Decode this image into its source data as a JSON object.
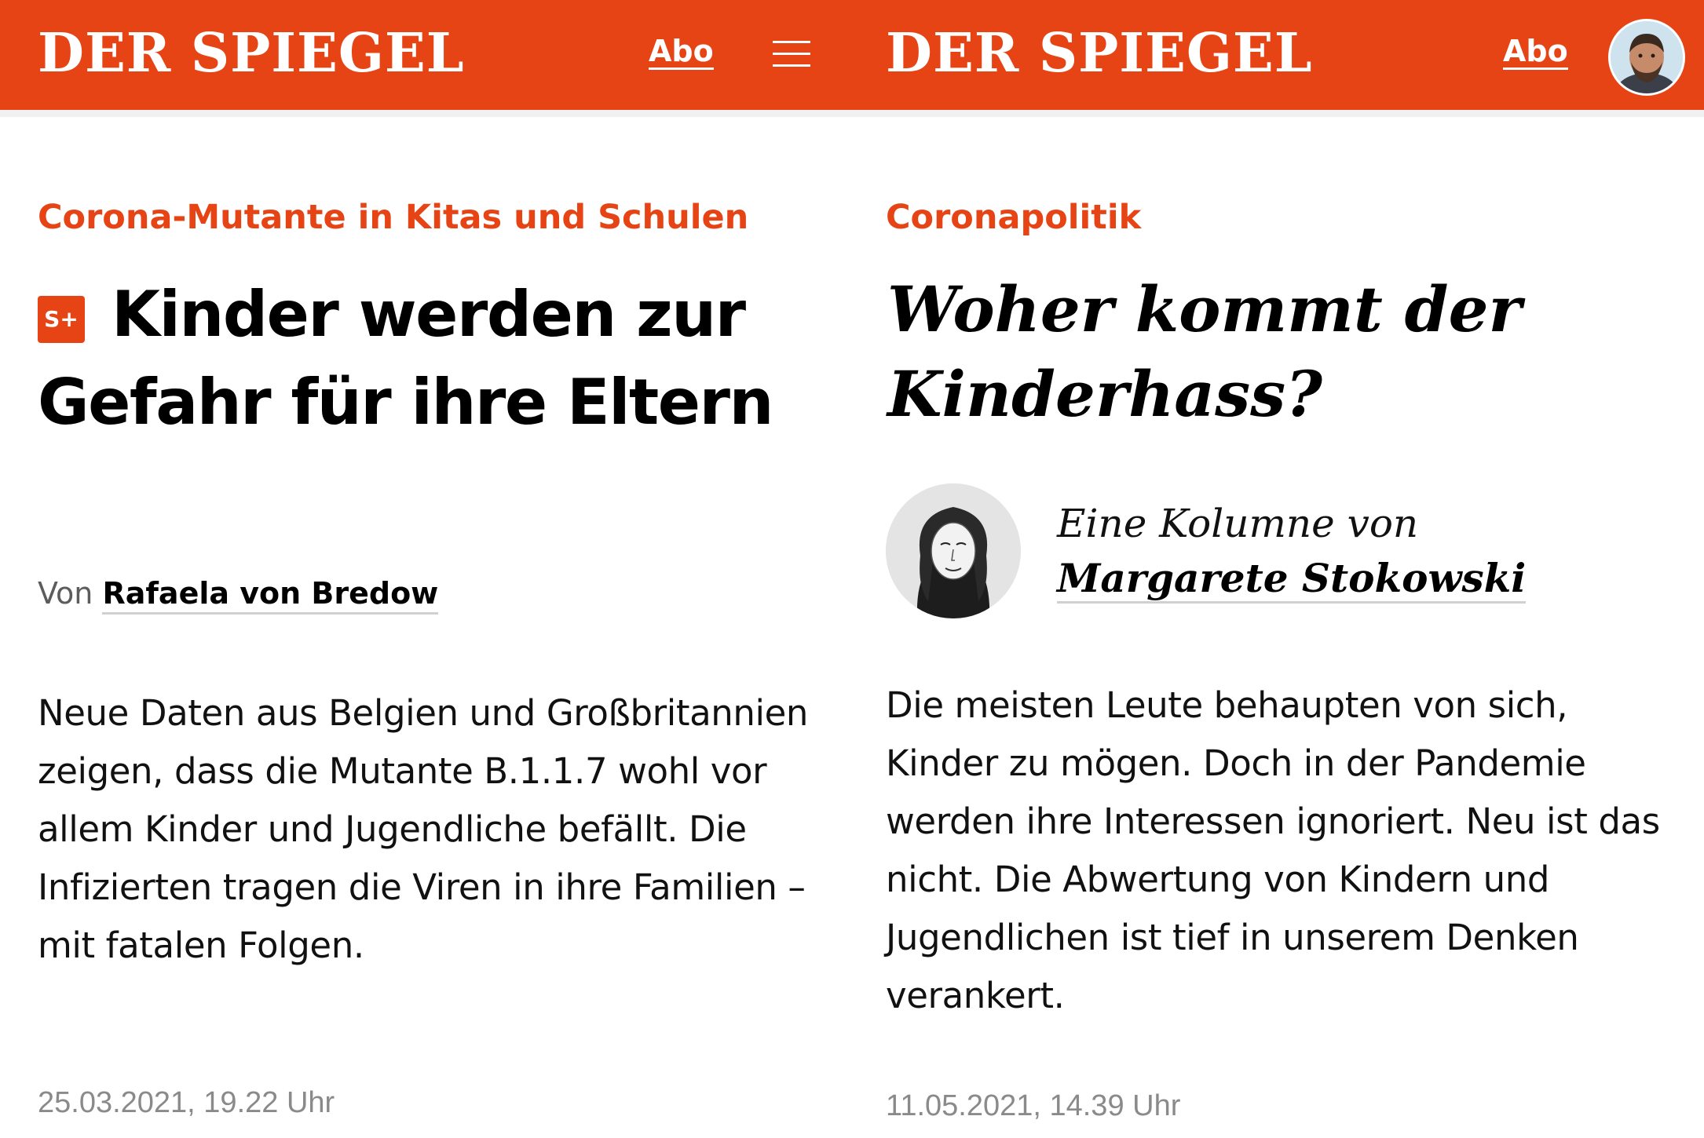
{
  "left": {
    "header": {
      "logo": "DER SPIEGEL",
      "abo_label": "Abo"
    },
    "kicker": "Corona-Mutante in Kitas und Schulen",
    "badge": "S+",
    "headline_line1": "Kinder werden zur",
    "headline_line2": "Gefahr für ihre Eltern",
    "byline_prefix": "Von",
    "author": "Rafaela von Bredow",
    "teaser": "Neue Daten aus Belgien und Großbritannien zeigen, dass die Mutante B.1.1.7 wohl vor allem Kinder und Jugendliche befällt. Die Infizierten tragen die Viren in ihre Familien – mit fatalen Folgen.",
    "date": "25.03.2021, 19.22 Uhr"
  },
  "right": {
    "header": {
      "logo": "DER SPIEGEL",
      "abo_label": "Abo"
    },
    "kicker": "Coronapolitik",
    "headline_line1": "Woher kommt der",
    "headline_line2": "Kinderhass?",
    "byline_prefix": "Eine Kolumne von",
    "author": "Margarete Stokowski",
    "teaser": "Die meisten Leute behaupten von sich, Kinder zu mögen. Doch in der Pandemie werden ihre Interessen ignoriert. Neu ist das nicht. Die Abwertung von Kindern und Jugendlichen ist tief in unserem Denken verankert.",
    "date": "11.05.2021, 14.39 Uhr"
  },
  "colors": {
    "brand": "#e64415",
    "text": "#111111",
    "muted": "#8a8a8a"
  },
  "icons": {
    "menu": "hamburger-icon",
    "user": "user-avatar-icon"
  }
}
